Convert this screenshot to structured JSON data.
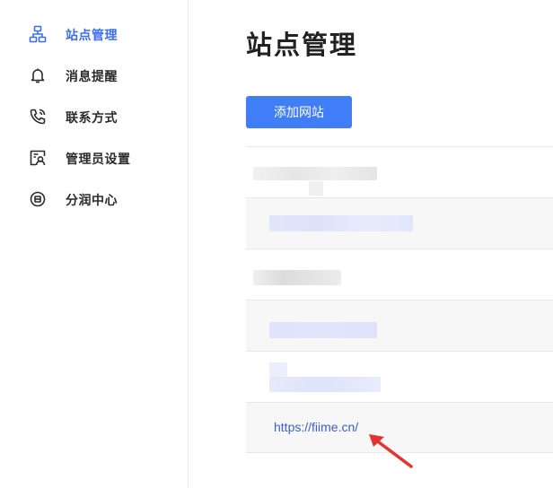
{
  "sidebar": {
    "items": [
      {
        "label": "站点管理",
        "icon": "sitemap-icon",
        "active": true
      },
      {
        "label": "消息提醒",
        "icon": "bell-icon",
        "active": false
      },
      {
        "label": "联系方式",
        "icon": "phone-icon",
        "active": false
      },
      {
        "label": "管理员设置",
        "icon": "admin-user-icon",
        "active": false
      },
      {
        "label": "分润中心",
        "icon": "share-center-icon",
        "active": false
      }
    ]
  },
  "main": {
    "title": "站点管理",
    "add_button_label": "添加网站",
    "sites": [
      {
        "url": "",
        "obscured": true
      },
      {
        "url": "",
        "obscured": true
      },
      {
        "url": "",
        "obscured": true
      },
      {
        "url": "",
        "obscured": true
      },
      {
        "url": "",
        "obscured": true
      },
      {
        "url": "https://fiime.cn/",
        "obscured": false
      }
    ]
  },
  "colors": {
    "accent": "#3a6ef5",
    "button": "#3f7ef6",
    "link": "#3a5fd0",
    "annotation_arrow": "#e8322f",
    "alt_row": "#f7f7f7"
  }
}
